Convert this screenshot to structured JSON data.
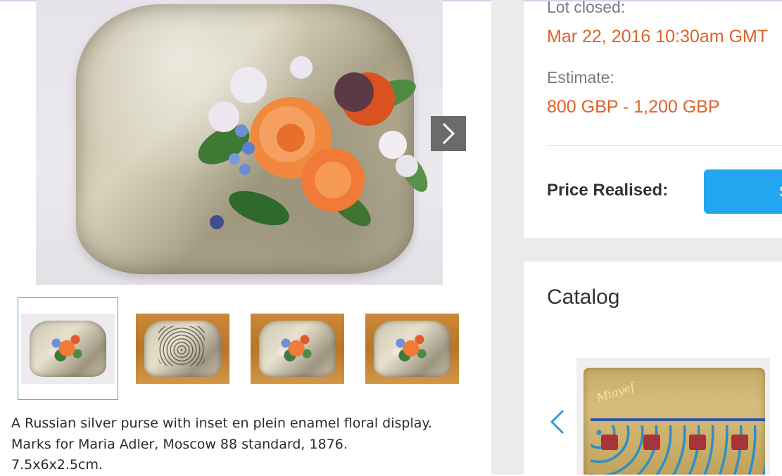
{
  "gallery": {
    "main_image_alt": "Russian silver purse with enamel floral display",
    "thumbnail_count": 4,
    "active_thumbnail": 1
  },
  "description": {
    "lines": [
      "A Russian silver purse with inset en plein enamel floral display.",
      "Marks for Maria Adler, Moscow 88 standard, 1876.",
      "7.5x6x2.5cm."
    ]
  },
  "lot": {
    "closed_label": "Lot closed:",
    "closed_value": "Mar 22, 2016 10:30am GMT",
    "estimate_label": "Estimate:",
    "estimate_value": "800 GBP - 1,200 GBP",
    "price_label": "Price Realised:",
    "price_button_label": "S"
  },
  "catalog": {
    "heading": "Catalog",
    "image_script": "Miayef"
  },
  "colors": {
    "accent_orange": "#e0612a",
    "button_blue": "#22a6f0",
    "thumb_active_border": "#3aa0e0"
  },
  "icons": {
    "next": "chevron-right-icon",
    "prev": "chevron-left-icon"
  }
}
